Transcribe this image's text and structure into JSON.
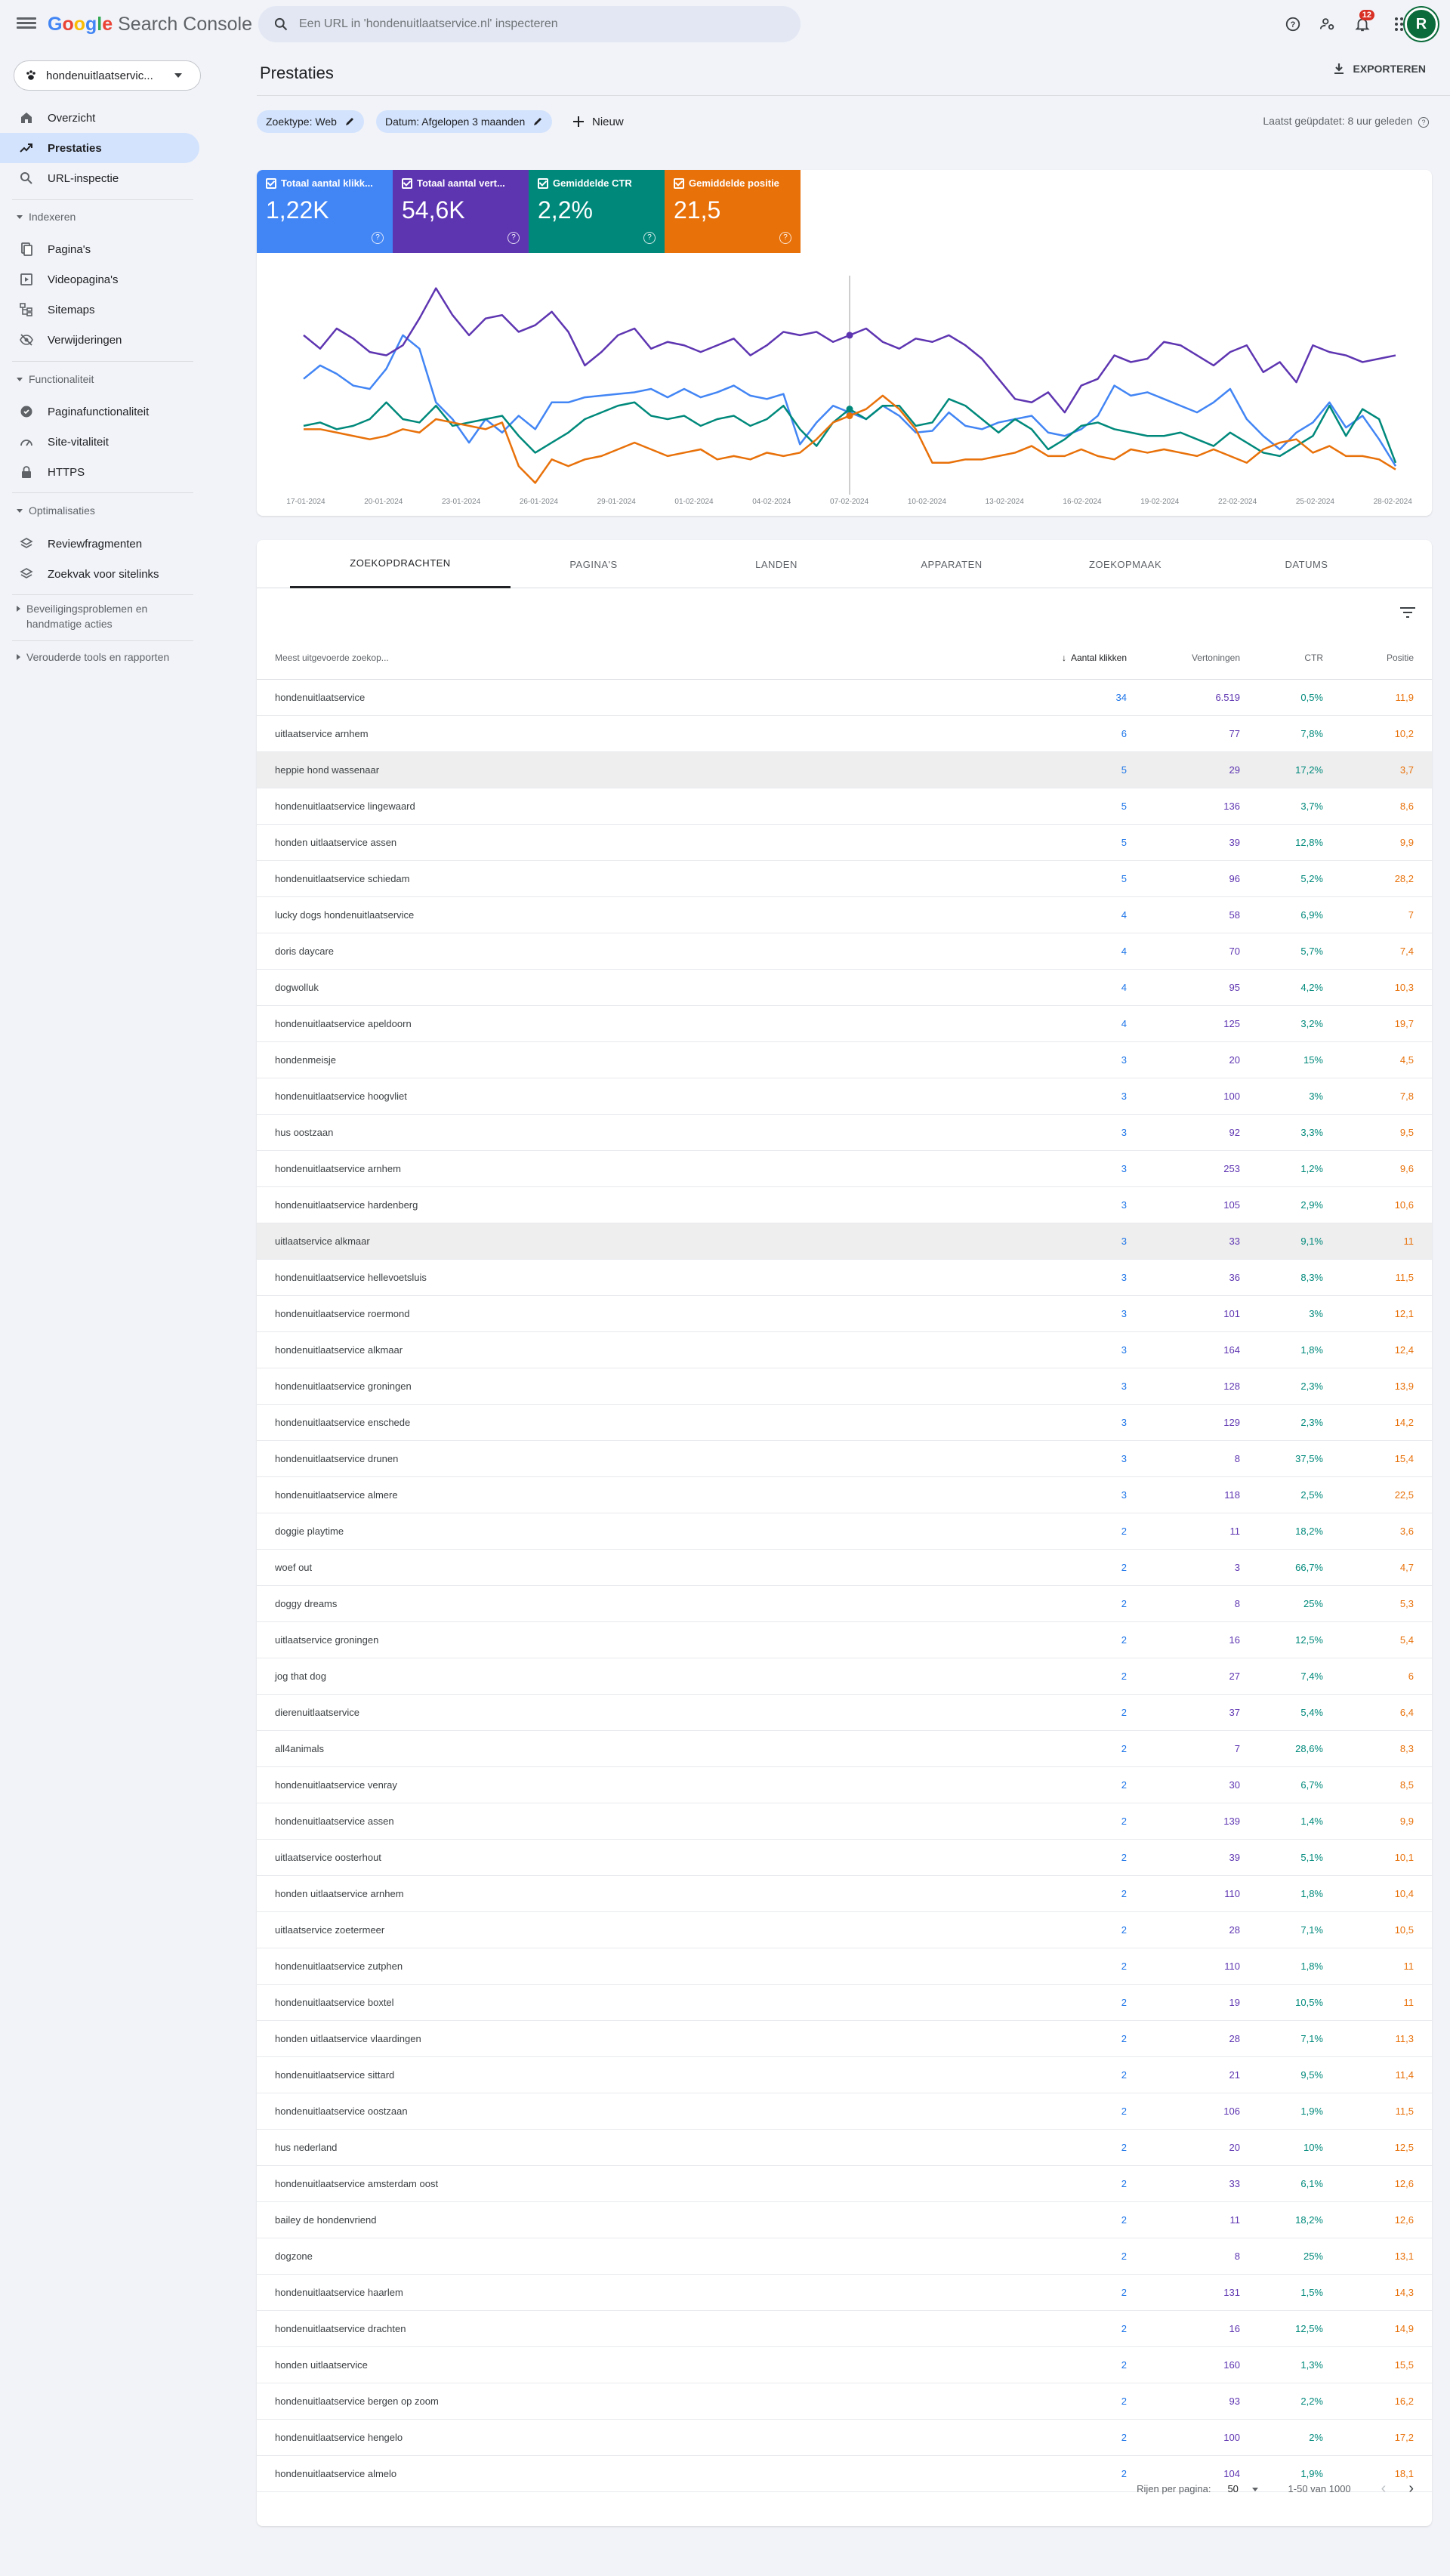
{
  "app": {
    "logo_google": "Google",
    "logo_product": "Search Console"
  },
  "search": {
    "placeholder": "Een URL in 'hondenuitlaatservice.nl' inspecteren"
  },
  "topbar": {
    "notifications_count": "12",
    "avatar_letter": "R"
  },
  "property": {
    "label": "hondenuitlaatservic..."
  },
  "nav": {
    "overzicht": "Overzicht",
    "prestaties": "Prestaties",
    "url_inspectie": "URL-inspectie",
    "section_indexeren": "Indexeren",
    "paginas": "Pagina's",
    "videopaginas": "Videopagina's",
    "sitemaps": "Sitemaps",
    "verwijderingen": "Verwijderingen",
    "section_functionaliteit": "Functionaliteit",
    "paginafunctionaliteit": "Paginafunctionaliteit",
    "site_vitaliteit": "Site-vitaliteit",
    "https": "HTTPS",
    "section_optimalisaties": "Optimalisaties",
    "reviewfragmenten": "Reviewfragmenten",
    "zoekvak": "Zoekvak voor sitelinks",
    "beveiliging_1": "Beveiligingsproblemen en",
    "beveiliging_2": "handmatige acties",
    "verouderde": "Verouderde tools en rapporten"
  },
  "page": {
    "title": "Prestaties",
    "export_label": "EXPORTEREN",
    "chip_type": "Zoektype: Web",
    "chip_date": "Datum: Afgelopen 3 maanden",
    "new_label": "Nieuw",
    "updated": "Laatst geüpdatet: 8 uur geleden"
  },
  "metrics": [
    {
      "label": "Totaal aantal klikk...",
      "value": "1,22K",
      "color": "#4285f4"
    },
    {
      "label": "Totaal aantal vert...",
      "value": "54,6K",
      "color": "#5e35b1"
    },
    {
      "label": "Gemiddelde CTR",
      "value": "2,2%",
      "color": "#00897b"
    },
    {
      "label": "Gemiddelde positie",
      "value": "21,5",
      "color": "#e8710a"
    }
  ],
  "chart_data": {
    "type": "line",
    "x_labels": [
      "17-01-2024",
      "20-01-2024",
      "23-01-2024",
      "26-01-2024",
      "29-01-2024",
      "01-02-2024",
      "04-02-2024",
      "07-02-2024",
      "10-02-2024",
      "13-02-2024",
      "16-02-2024",
      "19-02-2024",
      "22-02-2024",
      "25-02-2024",
      "28-02-2024"
    ],
    "series": [
      {
        "name": "Totaal aantal klikken",
        "color": "#4285f4",
        "values": [
          44,
          52,
          47,
          40,
          38,
          50,
          70,
          62,
          30,
          20,
          6,
          20,
          12,
          22,
          14,
          30,
          30,
          33,
          34,
          35,
          36,
          38,
          33,
          38,
          33,
          36,
          40,
          34,
          32,
          35,
          5,
          18,
          28,
          24,
          20,
          28,
          22,
          12,
          13,
          24,
          16,
          14,
          18,
          20,
          22,
          12,
          10,
          14,
          22,
          40,
          34,
          36,
          32,
          28,
          24,
          30,
          38,
          20,
          10,
          2,
          12,
          18,
          30,
          15,
          22,
          8,
          -8
        ]
      },
      {
        "name": "Totaal aantal vertoningen",
        "color": "#5e35b1",
        "values": [
          70,
          62,
          74,
          68,
          60,
          58,
          64,
          80,
          98,
          82,
          70,
          80,
          82,
          72,
          76,
          84,
          72,
          52,
          60,
          70,
          74,
          62,
          66,
          64,
          60,
          64,
          68,
          58,
          64,
          72,
          70,
          72,
          66,
          70,
          74,
          66,
          62,
          68,
          66,
          70,
          64,
          56,
          44,
          32,
          30,
          36,
          24,
          40,
          44,
          58,
          54,
          56,
          66,
          64,
          58,
          52,
          60,
          64,
          48,
          54,
          42,
          64,
          60,
          58,
          54,
          56,
          58
        ]
      },
      {
        "name": "Gemiddelde CTR",
        "color": "#00897b",
        "values": [
          16,
          18,
          14,
          16,
          20,
          30,
          20,
          18,
          28,
          16,
          18,
          20,
          22,
          10,
          0,
          6,
          12,
          20,
          24,
          28,
          30,
          22,
          20,
          22,
          16,
          20,
          22,
          16,
          20,
          28,
          14,
          4,
          18,
          26,
          20,
          28,
          28,
          16,
          18,
          32,
          28,
          20,
          12,
          20,
          14,
          2,
          8,
          16,
          18,
          14,
          12,
          10,
          10,
          12,
          8,
          4,
          12,
          6,
          0,
          -2,
          4,
          10,
          28,
          10,
          26,
          20,
          -6
        ]
      },
      {
        "name": "Gemiddelde positie",
        "color": "#e8710a",
        "values": [
          14,
          14,
          12,
          10,
          8,
          10,
          14,
          12,
          20,
          18,
          16,
          14,
          18,
          -8,
          -18,
          -4,
          -8,
          -4,
          -2,
          2,
          6,
          2,
          -2,
          0,
          2,
          -4,
          -2,
          -4,
          0,
          -2,
          0,
          8,
          18,
          22,
          26,
          34,
          26,
          14,
          -6,
          -6,
          -4,
          -4,
          -2,
          0,
          4,
          -2,
          -2,
          2,
          -2,
          -4,
          2,
          0,
          2,
          0,
          -2,
          2,
          -2,
          -6,
          2,
          6,
          8,
          0,
          4,
          -2,
          -2,
          -4,
          -10
        ]
      }
    ],
    "ylim": [
      -25,
      110
    ],
    "cursor_index": 33
  },
  "tabs": [
    "ZOEKOPDRACHTEN",
    "PAGINA'S",
    "LANDEN",
    "APPARATEN",
    "ZOEKOPMAAK",
    "DATUMS"
  ],
  "table": {
    "headers": {
      "query": "Meest uitgevoerde zoekop...",
      "clicks": "Aantal klikken",
      "impressions": "Vertoningen",
      "ctr": "CTR",
      "position": "Positie"
    },
    "rows": [
      [
        "hondenuitlaatservice",
        "34",
        "6.519",
        "0,5%",
        "11,9"
      ],
      [
        "uitlaatservice arnhem",
        "6",
        "77",
        "7,8%",
        "10,2"
      ],
      [
        "heppie hond wassenaar",
        "5",
        "29",
        "17,2%",
        "3,7"
      ],
      [
        "hondenuitlaatservice lingewaard",
        "5",
        "136",
        "3,7%",
        "8,6"
      ],
      [
        "honden uitlaatservice assen",
        "5",
        "39",
        "12,8%",
        "9,9"
      ],
      [
        "hondenuitlaatservice schiedam",
        "5",
        "96",
        "5,2%",
        "28,2"
      ],
      [
        "lucky dogs hondenuitlaatservice",
        "4",
        "58",
        "6,9%",
        "7"
      ],
      [
        "doris daycare",
        "4",
        "70",
        "5,7%",
        "7,4"
      ],
      [
        "dogwolluk",
        "4",
        "95",
        "4,2%",
        "10,3"
      ],
      [
        "hondenuitlaatservice apeldoorn",
        "4",
        "125",
        "3,2%",
        "19,7"
      ],
      [
        "hondenmeisje",
        "3",
        "20",
        "15%",
        "4,5"
      ],
      [
        "hondenuitlaatservice hoogvliet",
        "3",
        "100",
        "3%",
        "7,8"
      ],
      [
        "hus oostzaan",
        "3",
        "92",
        "3,3%",
        "9,5"
      ],
      [
        "hondenuitlaatservice arnhem",
        "3",
        "253",
        "1,2%",
        "9,6"
      ],
      [
        "hondenuitlaatservice hardenberg",
        "3",
        "105",
        "2,9%",
        "10,6"
      ],
      [
        "uitlaatservice alkmaar",
        "3",
        "33",
        "9,1%",
        "11"
      ],
      [
        "hondenuitlaatservice hellevoetsluis",
        "3",
        "36",
        "8,3%",
        "11,5"
      ],
      [
        "hondenuitlaatservice roermond",
        "3",
        "101",
        "3%",
        "12,1"
      ],
      [
        "hondenuitlaatservice alkmaar",
        "3",
        "164",
        "1,8%",
        "12,4"
      ],
      [
        "hondenuitlaatservice groningen",
        "3",
        "128",
        "2,3%",
        "13,9"
      ],
      [
        "hondenuitlaatservice enschede",
        "3",
        "129",
        "2,3%",
        "14,2"
      ],
      [
        "hondenuitlaatservice drunen",
        "3",
        "8",
        "37,5%",
        "15,4"
      ],
      [
        "hondenuitlaatservice almere",
        "3",
        "118",
        "2,5%",
        "22,5"
      ],
      [
        "doggie playtime",
        "2",
        "11",
        "18,2%",
        "3,6"
      ],
      [
        "woef out",
        "2",
        "3",
        "66,7%",
        "4,7"
      ],
      [
        "doggy dreams",
        "2",
        "8",
        "25%",
        "5,3"
      ],
      [
        "uitlaatservice groningen",
        "2",
        "16",
        "12,5%",
        "5,4"
      ],
      [
        "jog that dog",
        "2",
        "27",
        "7,4%",
        "6"
      ],
      [
        "dierenuitlaatservice",
        "2",
        "37",
        "5,4%",
        "6,4"
      ],
      [
        "all4animals",
        "2",
        "7",
        "28,6%",
        "8,3"
      ],
      [
        "hondenuitlaatservice venray",
        "2",
        "30",
        "6,7%",
        "8,5"
      ],
      [
        "hondenuitlaatservice assen",
        "2",
        "139",
        "1,4%",
        "9,9"
      ],
      [
        "uitlaatservice oosterhout",
        "2",
        "39",
        "5,1%",
        "10,1"
      ],
      [
        "honden uitlaatservice arnhem",
        "2",
        "110",
        "1,8%",
        "10,4"
      ],
      [
        "uitlaatservice zoetermeer",
        "2",
        "28",
        "7,1%",
        "10,5"
      ],
      [
        "hondenuitlaatservice zutphen",
        "2",
        "110",
        "1,8%",
        "11"
      ],
      [
        "hondenuitlaatservice boxtel",
        "2",
        "19",
        "10,5%",
        "11"
      ],
      [
        "honden uitlaatservice vlaardingen",
        "2",
        "28",
        "7,1%",
        "11,3"
      ],
      [
        "hondenuitlaatservice sittard",
        "2",
        "21",
        "9,5%",
        "11,4"
      ],
      [
        "hondenuitlaatservice oostzaan",
        "2",
        "106",
        "1,9%",
        "11,5"
      ],
      [
        "hus nederland",
        "2",
        "20",
        "10%",
        "12,5"
      ],
      [
        "hondenuitlaatservice amsterdam oost",
        "2",
        "33",
        "6,1%",
        "12,6"
      ],
      [
        "bailey de hondenvriend",
        "2",
        "11",
        "18,2%",
        "12,6"
      ],
      [
        "dogzone",
        "2",
        "8",
        "25%",
        "13,1"
      ],
      [
        "hondenuitlaatservice haarlem",
        "2",
        "131",
        "1,5%",
        "14,3"
      ],
      [
        "hondenuitlaatservice drachten",
        "2",
        "16",
        "12,5%",
        "14,9"
      ],
      [
        "honden uitlaatservice",
        "2",
        "160",
        "1,3%",
        "15,5"
      ],
      [
        "hondenuitlaatservice bergen op zoom",
        "2",
        "93",
        "2,2%",
        "16,2"
      ],
      [
        "hondenuitlaatservice hengelo",
        "2",
        "100",
        "2%",
        "17,2"
      ],
      [
        "hondenuitlaatservice almelo",
        "2",
        "104",
        "1,9%",
        "18,1"
      ]
    ],
    "highlighted_rows": [
      2,
      15
    ]
  },
  "pagination": {
    "rows_label": "Rijen per pagina:",
    "rows_value": "50",
    "range": "1-50 van 1000"
  }
}
